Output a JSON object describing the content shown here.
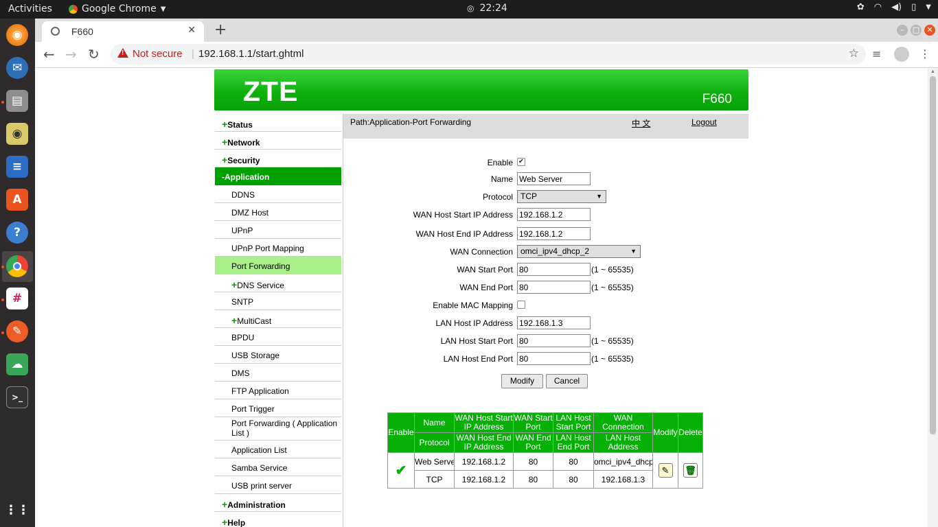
{
  "os": {
    "activities": "Activities",
    "app_name": "Google Chrome",
    "clock": "22:24"
  },
  "browser": {
    "tab_title": "F660",
    "not_secure": "Not secure",
    "url": "192.168.1.1/start.ghtml"
  },
  "router": {
    "brand": "ZTE",
    "model": "F660",
    "path": "Path:Application-Port Forwarding",
    "language_link": "中 文",
    "logout": "Logout"
  },
  "menu": {
    "status": "Status",
    "network": "Network",
    "security": "Security",
    "application": "Application",
    "ddns": "DDNS",
    "dmz_host": "DMZ Host",
    "upnp": "UPnP",
    "upnp_port_mapping": "UPnP Port Mapping",
    "port_forwarding": "Port Forwarding",
    "dns_service": "DNS Service",
    "sntp": "SNTP",
    "multicast": "MultiCast",
    "bpdu": "BPDU",
    "usb_storage": "USB Storage",
    "dms": "DMS",
    "ftp_application": "FTP Application",
    "port_trigger": "Port Trigger",
    "pf_app_list": "Port Forwarding ( Application List )",
    "application_list": "Application List",
    "samba_service": "Samba Service",
    "usb_print_server": "USB print server",
    "administration": "Administration",
    "help": "Help"
  },
  "form": {
    "enable_label": "Enable",
    "enable_checked": true,
    "name_label": "Name",
    "name_value": "Web Server",
    "protocol_label": "Protocol",
    "protocol_value": "TCP",
    "wan_start_ip_label": "WAN Host Start IP Address",
    "wan_start_ip_value": "192.168.1.2",
    "wan_end_ip_label": "WAN Host End IP Address",
    "wan_end_ip_value": "192.168.1.2",
    "wan_connection_label": "WAN Connection",
    "wan_connection_value": "omci_ipv4_dhcp_2",
    "wan_start_port_label": "WAN Start Port",
    "wan_start_port_value": "80",
    "wan_end_port_label": "WAN End Port",
    "wan_end_port_value": "80",
    "mac_mapping_label": "Enable MAC Mapping",
    "mac_mapping_checked": false,
    "lan_ip_label": "LAN Host IP Address",
    "lan_ip_value": "192.168.1.3",
    "lan_start_port_label": "LAN Host Start Port",
    "lan_start_port_value": "80",
    "lan_end_port_label": "LAN Host End Port",
    "lan_end_port_value": "80",
    "port_range": "(1 ~ 65535)",
    "modify_button": "Modify",
    "cancel_button": "Cancel"
  },
  "table": {
    "headers": {
      "enable": "Enable",
      "name": "Name",
      "protocol": "Protocol",
      "wan_start_ip": "WAN Host Start IP Address",
      "wan_end_ip": "WAN Host End IP Address",
      "wan_start_port": "WAN Start Port",
      "wan_end_port": "WAN End Port",
      "lan_start_port": "LAN Host Start Port",
      "lan_end_port": "LAN Host End Port",
      "wan_connection": "WAN Connection",
      "lan_host_address": "LAN Host Address",
      "modify": "Modify",
      "delete": "Delete"
    },
    "row": {
      "name": "Web Serve",
      "protocol": "TCP",
      "wan_start_ip": "192.168.1.2",
      "wan_end_ip": "192.168.1.2",
      "wan_start_port": "80",
      "wan_end_port": "80",
      "lan_start_port": "80",
      "lan_end_port": "80",
      "wan_connection": "omci_ipv4_dhcp",
      "lan_host_address": "192.168.1.3"
    }
  },
  "colors": {
    "zte_green": "#07b007",
    "menu_active": "#aaf08a",
    "not_secure_red": "#c5221f"
  }
}
